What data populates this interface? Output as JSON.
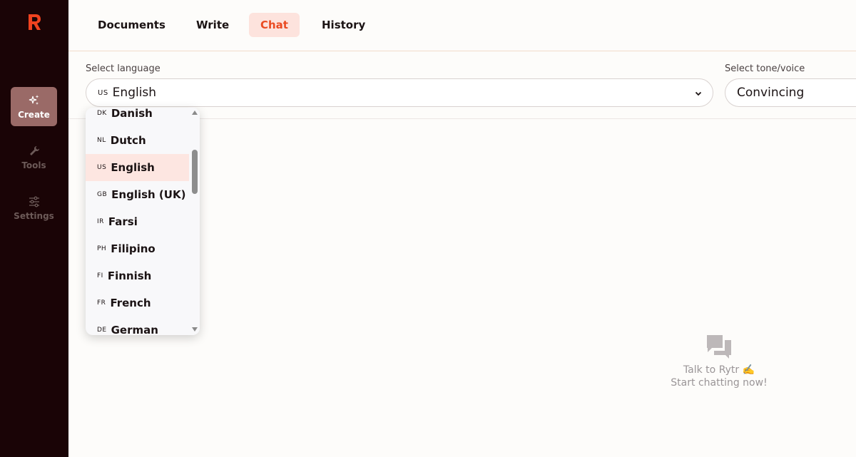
{
  "sidebar": {
    "items": [
      {
        "label": "Create",
        "icon": "sparkle-icon",
        "active": true
      },
      {
        "label": "Tools",
        "icon": "wrench-icon",
        "active": false
      },
      {
        "label": "Settings",
        "icon": "sliders-icon",
        "active": false
      }
    ]
  },
  "nav": {
    "tabs": [
      {
        "label": "Documents"
      },
      {
        "label": "Write"
      },
      {
        "label": "Chat",
        "active": true
      },
      {
        "label": "History"
      }
    ]
  },
  "language": {
    "label": "Select language",
    "selected_code": "US",
    "selected": "English"
  },
  "tone": {
    "label": "Select tone/voice",
    "selected": "Convincing"
  },
  "dropdown": {
    "options": [
      {
        "code": "DK",
        "name": "Danish"
      },
      {
        "code": "NL",
        "name": "Dutch"
      },
      {
        "code": "US",
        "name": "English",
        "selected": true
      },
      {
        "code": "GB",
        "name": "English (UK)"
      },
      {
        "code": "IR",
        "name": "Farsi"
      },
      {
        "code": "PH",
        "name": "Filipino"
      },
      {
        "code": "FI",
        "name": "Finnish"
      },
      {
        "code": "FR",
        "name": "French"
      },
      {
        "code": "DE",
        "name": "German"
      }
    ]
  },
  "chat_empty": {
    "line1": "Talk to Rytr ✍️",
    "line2": "Start chatting now!"
  },
  "colors": {
    "sidebar_bg": "#1a0406",
    "accent": "#ea4b22",
    "active_tab_bg": "#fde3dd",
    "selected_option_bg": "#fde6e1"
  }
}
